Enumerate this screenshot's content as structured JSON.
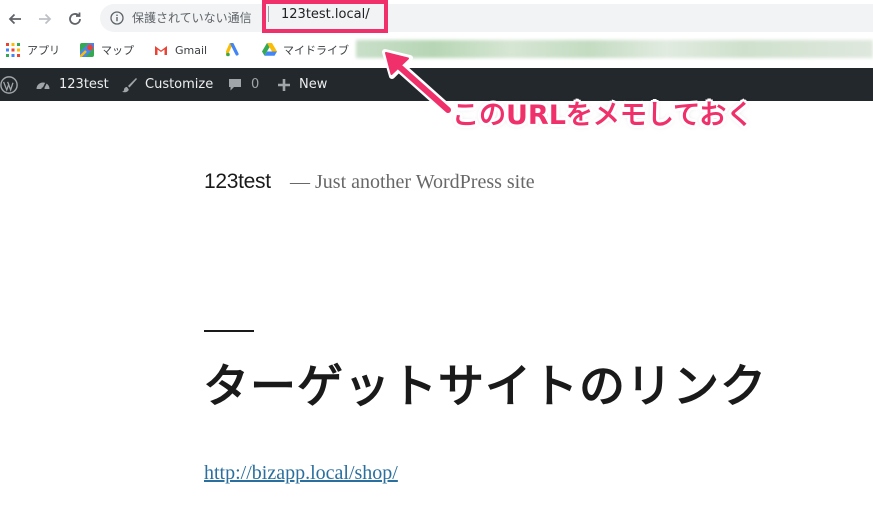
{
  "browser": {
    "security_label": "保護されていない通信",
    "url": "123test.local/"
  },
  "bookmarks": [
    {
      "label": "アプリ",
      "icon": "apps-grid-icon"
    },
    {
      "label": "マップ",
      "icon": "maps-icon"
    },
    {
      "label": "Gmail",
      "icon": "gmail-icon"
    },
    {
      "label": "",
      "icon": "ads-icon"
    },
    {
      "label": "マイドライブ",
      "icon": "drive-icon"
    }
  ],
  "adminbar": {
    "site_name": "123test",
    "customize": "Customize",
    "comments_count": "0",
    "new": "New"
  },
  "site": {
    "title": "123test",
    "description": "— Just another WordPress site"
  },
  "entry": {
    "title": "ターゲットサイトのリンク",
    "link": "http://bizapp.local/shop/"
  },
  "annotation": {
    "text": "このURLをメモしておく",
    "color": "#f0306a"
  },
  "colors": {
    "adminbar_bg": "#23282d",
    "link": "#2a6f9e",
    "highlight": "#f0306a"
  }
}
